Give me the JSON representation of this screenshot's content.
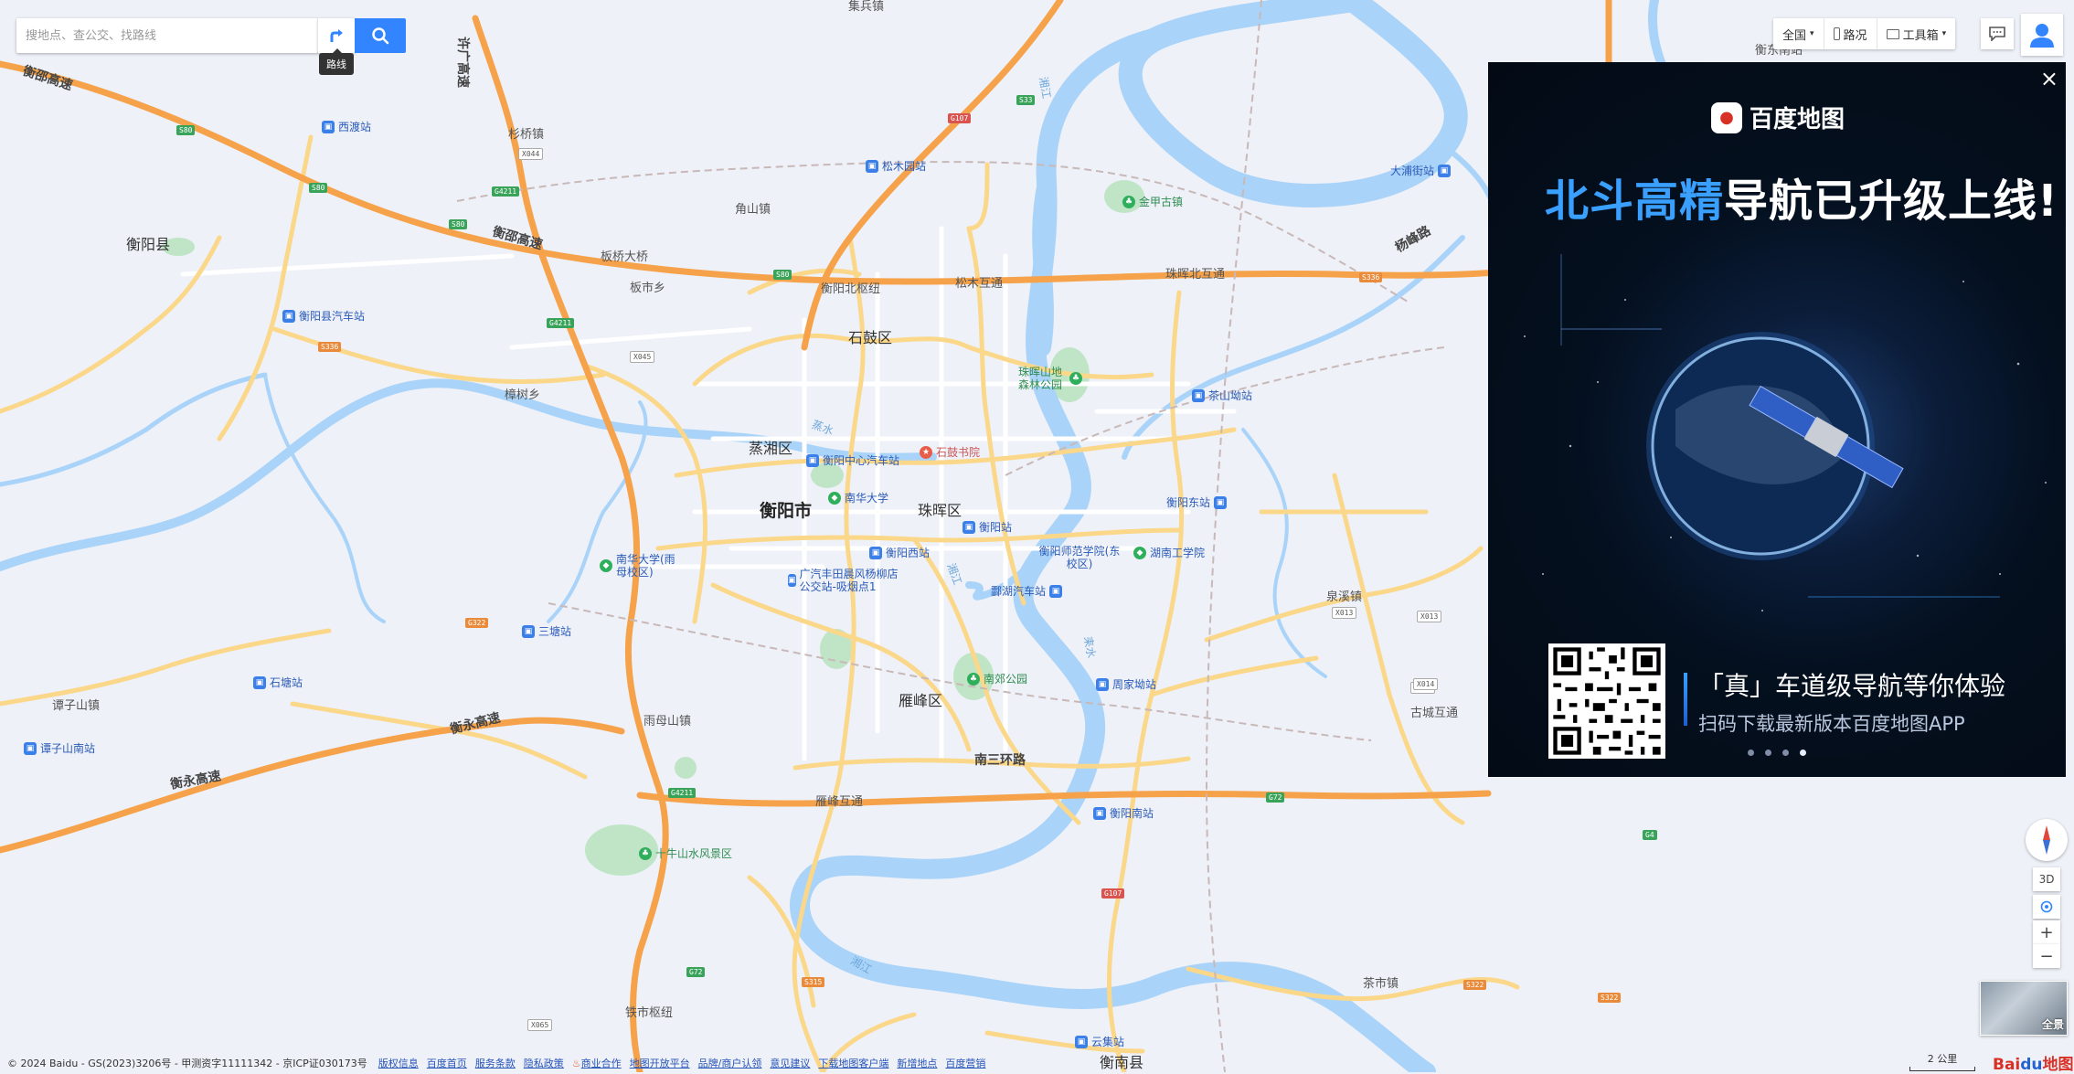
{
  "search": {
    "placeholder": "搜地点、查公交、找路线",
    "route_tooltip": "路线"
  },
  "toolbar": {
    "region": "全国",
    "traffic": "路况",
    "toolbox": "工具箱"
  },
  "ad": {
    "logo_text": "百度地图",
    "headline_highlight": "北斗高精",
    "headline_rest": "导航已升级上线!",
    "subline_1": "「真」车道级导航等你体验",
    "subline_2": "扫码下载最新版本百度地图APP"
  },
  "map_controls": {
    "three_d": "3D",
    "zoom_in": "+",
    "zoom_out": "−",
    "panorama": "全景"
  },
  "footer": {
    "copyright": "© 2024 Baidu - GS(2023)3206号 - 甲测资字11111342 - 京ICP证030173号",
    "links": [
      "版权信息",
      "百度首页",
      "服务条款",
      "隐私政策",
      "商业合作",
      "地图开放平台",
      "品牌/商户认领",
      "意见建议",
      "下载地图客户端",
      "新增地点",
      "百度营销"
    ]
  },
  "scale_label": "2 公里",
  "baidu_logo": {
    "a": "Bai",
    "b": "du",
    "c": "地图"
  },
  "map_labels": {
    "city": "衡阳市",
    "districts": [
      "石鼓区",
      "蒸湘区",
      "珠晖区",
      "雁峰区",
      "衡阳县",
      "衡南县"
    ],
    "towns": [
      "杉桥镇",
      "角山镇",
      "板市乡",
      "樟树乡",
      "雨母山镇",
      "谭子山镇",
      "泉溪镇",
      "茶市镇",
      "古城互通",
      "集兵镇",
      "衡东南站"
    ],
    "roads": [
      "衡邵高速",
      "衡邵高速",
      "衡永高速",
      "衡永高速",
      "南三环路",
      "杨峰路",
      "许广高速",
      "板桥大桥",
      "衡阳北枢纽",
      "松木互通",
      "珠晖北互通",
      "雁峰互通",
      "铁市枢纽"
    ],
    "pois_bus": [
      "西渡站",
      "衡阳县汽车站",
      "松木园站",
      "茶山坳站",
      "衡阳中心汽车站",
      "衡阳站",
      "衡阳西站",
      "衡阳东站",
      "广汽丰田晨风杨柳店公交站-吸烟点1",
      "酃湖汽车站",
      "周家坳站",
      "三塘站",
      "石塘站",
      "谭子山南站",
      "衡阳南站",
      "云集站",
      "大浦街站"
    ],
    "pois_scenic": [
      "金甲古镇",
      "珠晖山地森林公园",
      "南华大学",
      "南华大学(雨母校区)",
      "湖南工学院",
      "南郊公园",
      "十牛山水风景区"
    ],
    "pois_other": [
      "石鼓书院",
      "衡阳师范学院(东校区)"
    ],
    "shields": [
      "S80",
      "S80",
      "S80",
      "G4211",
      "G4211",
      "G4211",
      "S80",
      "X044",
      "X045",
      "S336",
      "G107",
      "G107",
      "S33",
      "G72",
      "S315",
      "X065",
      "X013",
      "X014",
      "G4",
      "S322",
      "S322",
      "G322",
      "S336",
      "G72",
      "X013",
      "X014"
    ],
    "rivers": [
      "湘江",
      "蒸水",
      "耒水",
      "湘江",
      "湘江"
    ]
  }
}
